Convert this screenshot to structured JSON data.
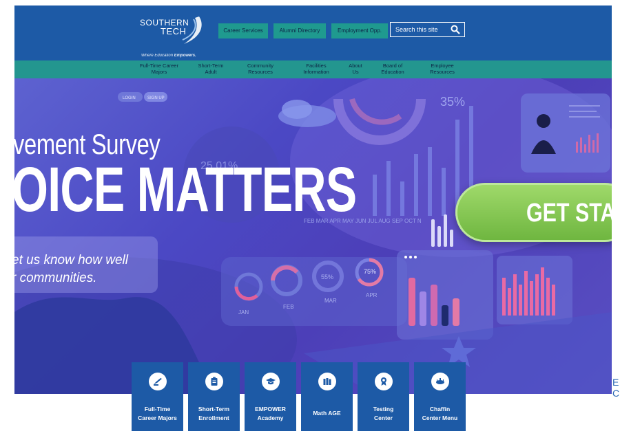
{
  "logo": {
    "line1": "SOUTHERN",
    "line2": "TECH",
    "tagline_prefix": "Where Education ",
    "tagline_strong": "Empowers."
  },
  "top_links": {
    "career_services": "Career Services",
    "alumni_directory": "Alumni Directory",
    "employment_opp": "Employment Opp."
  },
  "search": {
    "label": "Search this site",
    "icon": "search-icon"
  },
  "nav": {
    "items": [
      {
        "label": "Full-Time Career\nMajors"
      },
      {
        "label": "Short-Term\nAdult"
      },
      {
        "label": "Community\nResources"
      },
      {
        "label": "Facilities\nInformation"
      },
      {
        "label": "About\nUs"
      },
      {
        "label": "Board of\nEducation"
      },
      {
        "label": "Employee\nResources"
      }
    ]
  },
  "hero": {
    "subtitle": "vement Survey",
    "title": "OICE MATTERS",
    "body": "et us know how well\nr communities.",
    "cta": "GET STAR",
    "decor": {
      "pct_35": "35%",
      "pct_2501": "25.01%",
      "pct_55": "55%",
      "pct_75": "75%",
      "months": "FEB  MAR  APR  MAY  JUN  JUL  AUG  SEP  OCT  N",
      "jan": "JAN",
      "feb": "FEB",
      "mar": "MAR",
      "apr": "APR",
      "login": "LOGIN",
      "signup": "SIGN UP"
    }
  },
  "tiles": [
    {
      "label": "Full-Time\nCareer Majors",
      "icon": "hand-pen-icon"
    },
    {
      "label": "Short-Term\nEnrollment",
      "icon": "clipboard-icon"
    },
    {
      "label": "EMPOWER\nAcademy",
      "icon": "graduation-cap-icon"
    },
    {
      "label": "Math AGE",
      "icon": "books-icon"
    },
    {
      "label": "Testing\nCenter",
      "icon": "award-ribbon-icon"
    },
    {
      "label": "Chaffin\nCenter Menu",
      "icon": "dining-icon"
    }
  ],
  "side_text": "E\nC",
  "colors": {
    "header": "#1d5aa6",
    "nav": "#23968f",
    "button": "#1f9a8f",
    "cta": "#8ccc58"
  }
}
